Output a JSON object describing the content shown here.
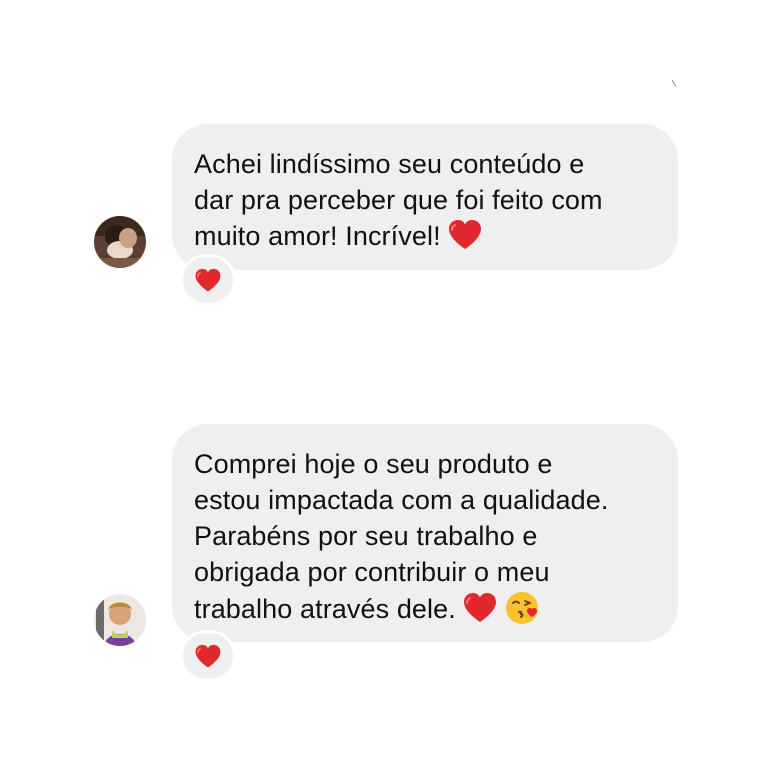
{
  "messages": [
    {
      "text": "Achei lindíssimo seu conteúdo e\ndar pra perceber que foi feito com\nmuito amor! Incrível!",
      "inline_emojis": [
        "red-heart"
      ],
      "reaction": "red-heart",
      "avatar": "user-avatar-1"
    },
    {
      "text": "Comprei hoje o seu produto e\nestou impactada com a qualidade.\nParabéns por seu trabalho e\nobrigada por contribuir o meu\ntrabalho através dele.",
      "inline_emojis": [
        "red-heart",
        "face-blowing-kiss"
      ],
      "reaction": "red-heart",
      "avatar": "user-avatar-2"
    }
  ],
  "colors": {
    "bubble": "#efefef",
    "text": "#111111",
    "heart": "#e0282e",
    "background": "#ffffff"
  }
}
